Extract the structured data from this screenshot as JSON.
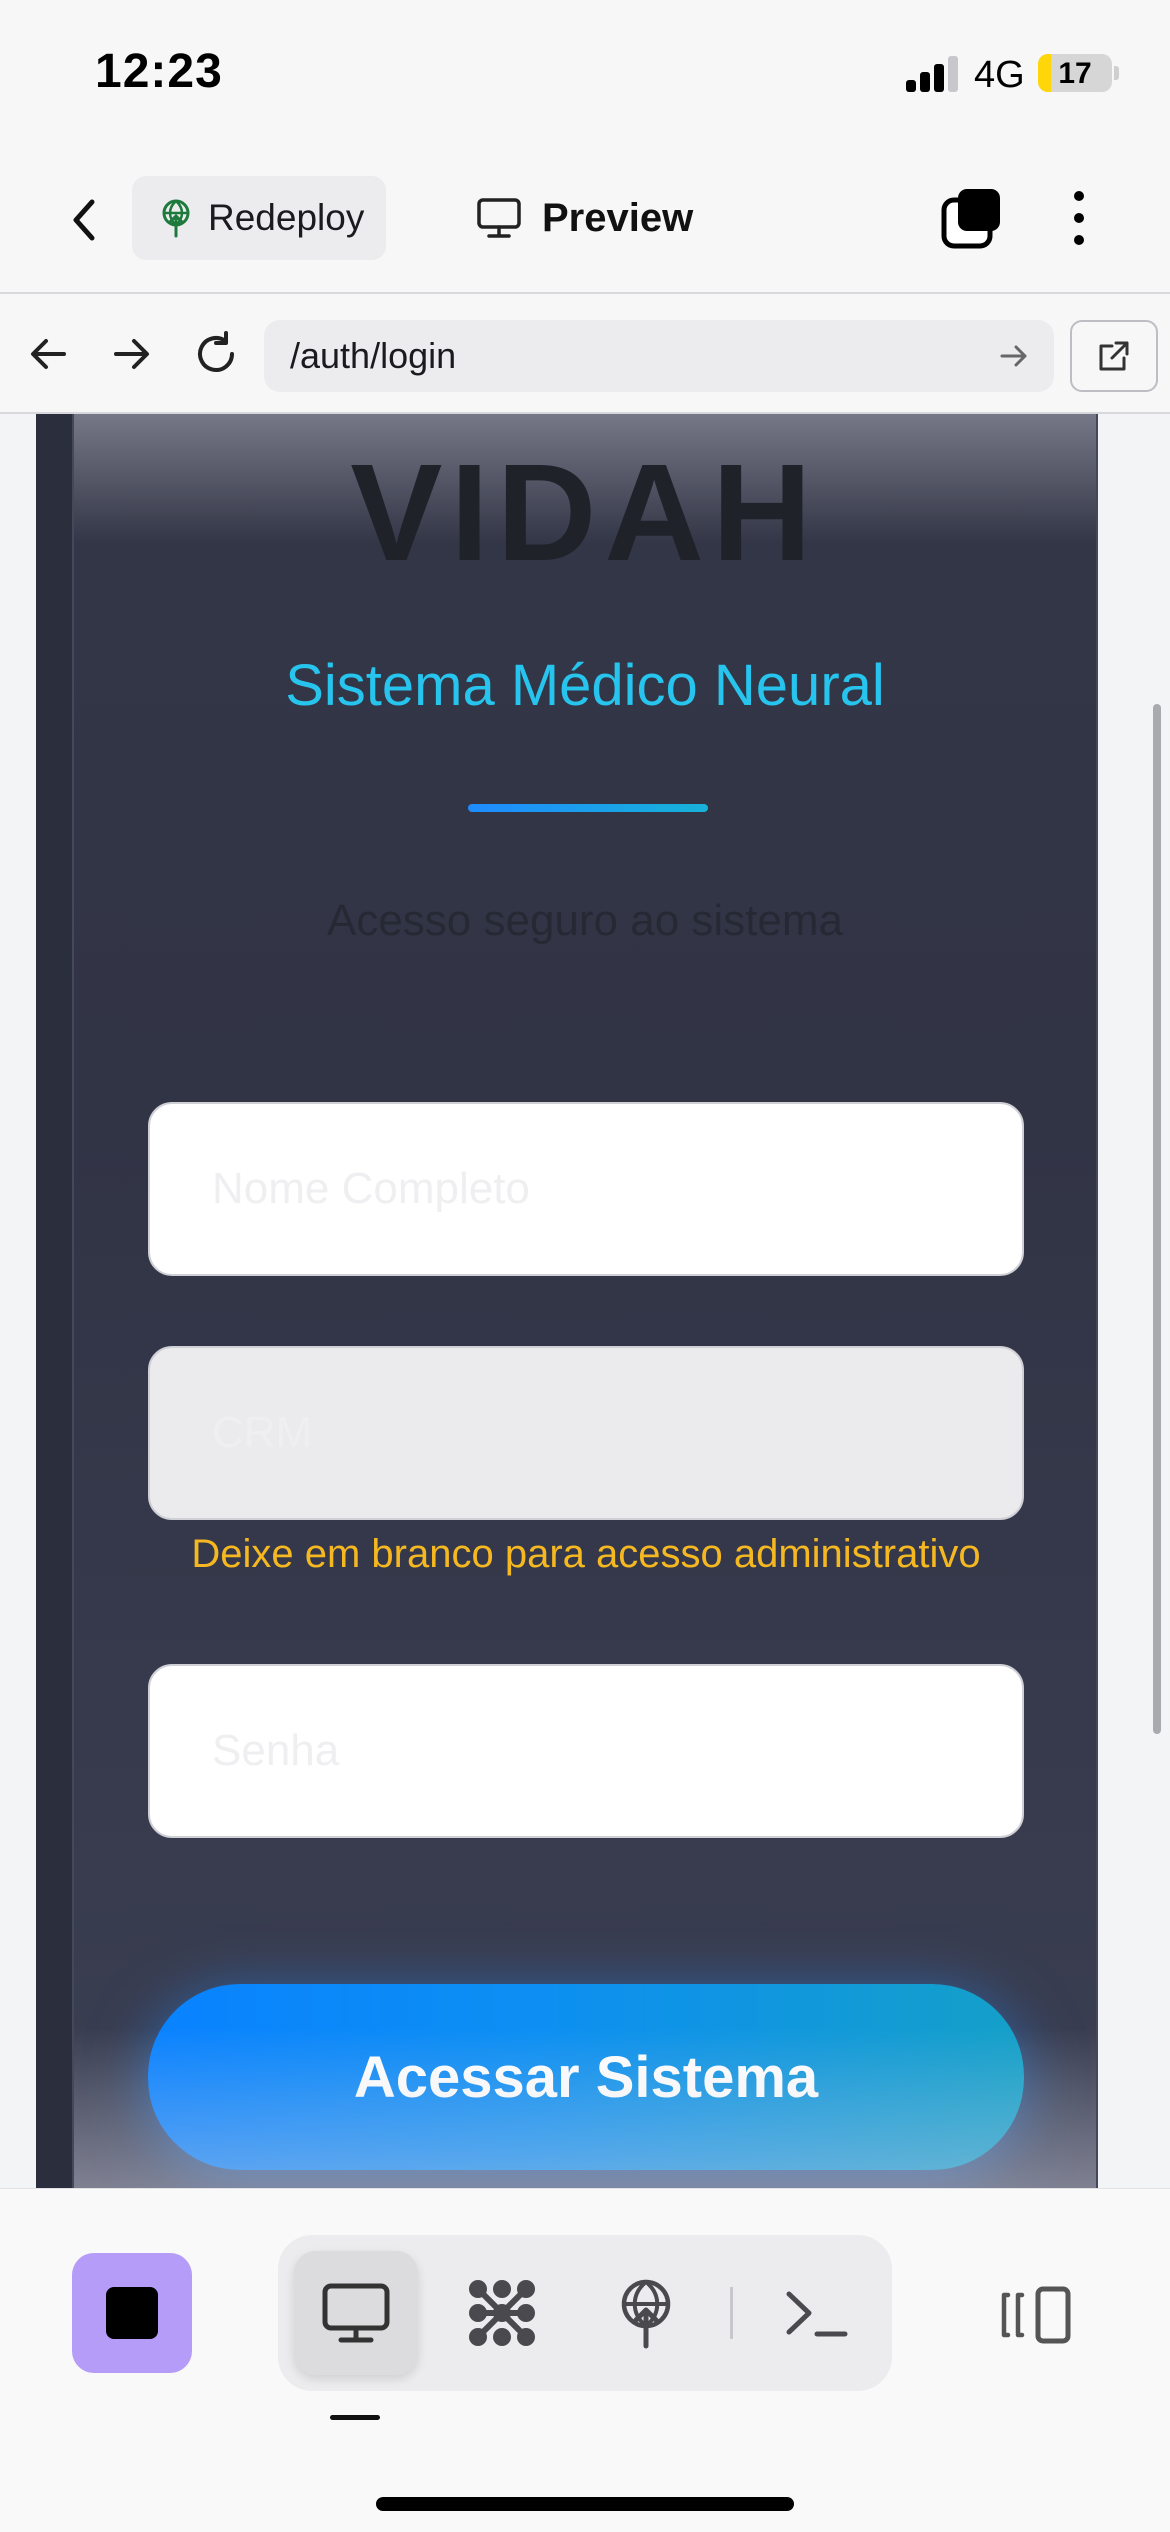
{
  "status_bar": {
    "time": "12:23",
    "network": "4G",
    "battery": "17",
    "battery_level": 0.17
  },
  "app_header": {
    "redeploy_label": "Redeploy",
    "preview_label": "Preview",
    "icons": [
      "back-icon",
      "redeploy-icon",
      "monitor-icon",
      "tabs-icon",
      "more-vertical-icon"
    ]
  },
  "browser_bar": {
    "url": "/auth/login",
    "icons": [
      "back-arrow-icon",
      "forward-arrow-icon",
      "reload-icon",
      "go-arrow-icon",
      "open-external-icon"
    ]
  },
  "login": {
    "brand": "VIDAH",
    "subtitle": "Sistema Médico Neural",
    "tagline": "Acesso seguro ao sistema",
    "name_placeholder": "Nome Completo",
    "crm_placeholder": "CRM",
    "crm_hint": "Deixe em branco para acesso administrativo",
    "password_placeholder": "Senha",
    "submit_label": "Acessar Sistema"
  },
  "colors": {
    "accent_cyan": "#27c4ee",
    "hint_yellow": "#f5b820",
    "button_blue": "#0a82ff",
    "card_bg": "#313445",
    "stop_purple": "#b49cf8"
  },
  "bottom_toolbar": {
    "icons": [
      "stop-icon",
      "monitor-icon",
      "network-icon",
      "deploy-icon",
      "terminal-icon",
      "panel-toggle-icon"
    ],
    "active_tool": "monitor-icon"
  }
}
